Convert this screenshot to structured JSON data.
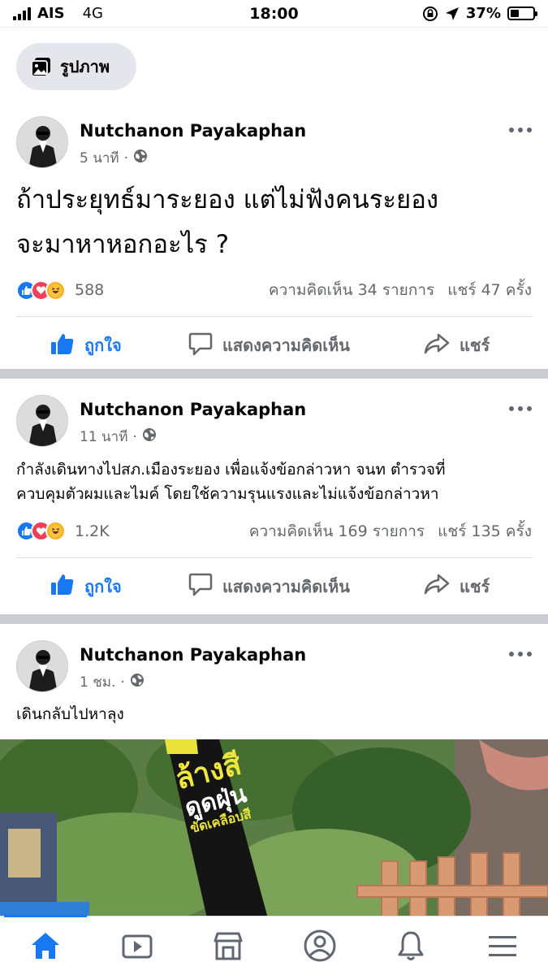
{
  "status_bar": {
    "carrier": "AIS",
    "network": "4G",
    "time": "18:00",
    "battery": "37%",
    "battery_level": 0.37
  },
  "chip": {
    "label": "รูปภาพ",
    "icon": "photo-icon"
  },
  "posts": [
    {
      "author": "Nutchanon Payakaphan",
      "time": "5 นาที",
      "privacy_icon": "globe-icon",
      "text_lines": [
        "ถ้าประยุทธ์มาระยอง แต่ไม่ฟังคนระยอง",
        "จะมาหาหอกอะไร ?"
      ],
      "reaction_count": "588",
      "reaction_types": [
        "like",
        "love",
        "haha"
      ],
      "comments": "ความคิดเห็น 34 รายการ",
      "shares": "แชร์ 47 ครั้ง"
    },
    {
      "author": "Nutchanon Payakaphan",
      "time": "11 นาที",
      "privacy_icon": "globe-icon",
      "text_lines": [
        "กำลังเดินทางไปสภ.เมืองระยอง เพื่อแจ้งข้อกล่าวหา จนท ตำรวจที่",
        "ควบคุมตัวผมและไมค์ โดยใช้ความรุนแรงและไม่แจ้งข้อกล่าวหา"
      ],
      "reaction_count": "1.2K",
      "reaction_types": [
        "like",
        "love",
        "care"
      ],
      "comments": "ความคิดเห็น 169 รายการ",
      "shares": "แชร์ 135 ครั้ง"
    },
    {
      "author": "Nutchanon Payakaphan",
      "time": "1 ชม.",
      "privacy_icon": "globe-icon",
      "text_lines": [
        "เดินกลับไปหาลุง"
      ],
      "photo_sign_lines": [
        "ล้างสี",
        "ดูดฝุ่น",
        "ขัดเคลือบสี"
      ]
    }
  ],
  "actions": {
    "like": "ถูกใจ",
    "comment": "แสดงความคิดเห็น",
    "share": "แชร์"
  },
  "tabs": [
    {
      "name": "home",
      "icon": "home-icon",
      "active": true
    },
    {
      "name": "watch",
      "icon": "video-icon"
    },
    {
      "name": "marketplace",
      "icon": "marketplace-icon"
    },
    {
      "name": "profile",
      "icon": "profile-icon"
    },
    {
      "name": "notifications",
      "icon": "bell-icon"
    },
    {
      "name": "menu",
      "icon": "menu-icon"
    }
  ],
  "colors": {
    "brand": "#1877f2",
    "secondary_text": "#65676b",
    "divider": "#c9ccd1",
    "chip_bg": "#e4e6eb"
  }
}
